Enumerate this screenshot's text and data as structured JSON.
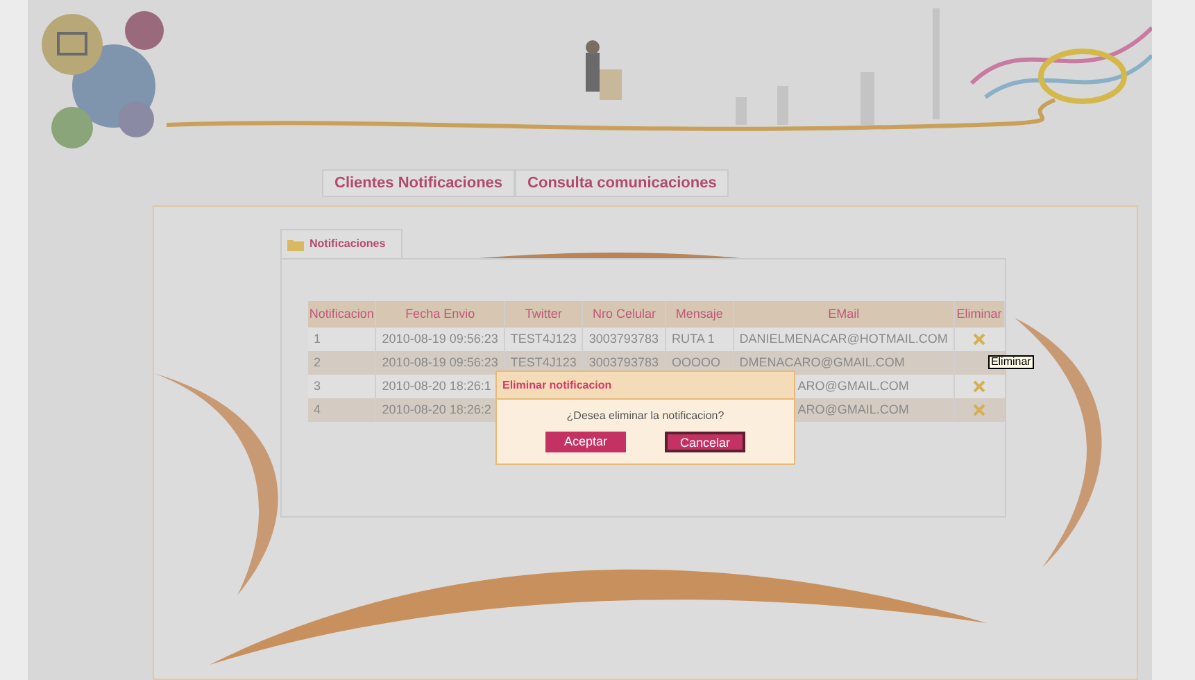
{
  "nav_tabs": [
    {
      "label": "Clientes Notificaciones"
    },
    {
      "label": "Consulta comunicaciones"
    }
  ],
  "panel": {
    "tab": "Notificaciones"
  },
  "table": {
    "columns": [
      "Notificacion",
      "Fecha Envio",
      "Twitter",
      "Nro Celular",
      "Mensaje",
      "EMail",
      "Eliminar"
    ],
    "rows": [
      {
        "cells": [
          "1",
          "2010-08-19 09:56:23",
          "TEST4J123",
          "3003793783",
          "RUTA 1",
          "DANIELMENACAR@HOTMAIL.COM"
        ],
        "covered": false,
        "delete": true
      },
      {
        "cells": [
          "2",
          "2010-08-19 09:56:23",
          "TEST4J123",
          "3003793783",
          "OOOOO",
          "DMENACARO@GMAIL.COM"
        ],
        "tooltip": "Eliminar",
        "covered": false,
        "delete": false
      },
      {
        "cells": [
          "3",
          "2010-08-20 18:26:1",
          "",
          "",
          "",
          "ARO@GMAIL.COM"
        ],
        "covered": true,
        "delete": true
      },
      {
        "cells": [
          "4",
          "2010-08-20 18:26:2",
          "",
          "",
          "",
          "ARO@GMAIL.COM"
        ],
        "covered": true,
        "delete": true
      }
    ]
  },
  "dialog": {
    "title": "Eliminar notificacion",
    "message": "¿Desea eliminar la notificacion?",
    "buttons": [
      {
        "label": "Aceptar",
        "focused": false
      },
      {
        "label": "Cancelar",
        "focused": true
      }
    ]
  }
}
